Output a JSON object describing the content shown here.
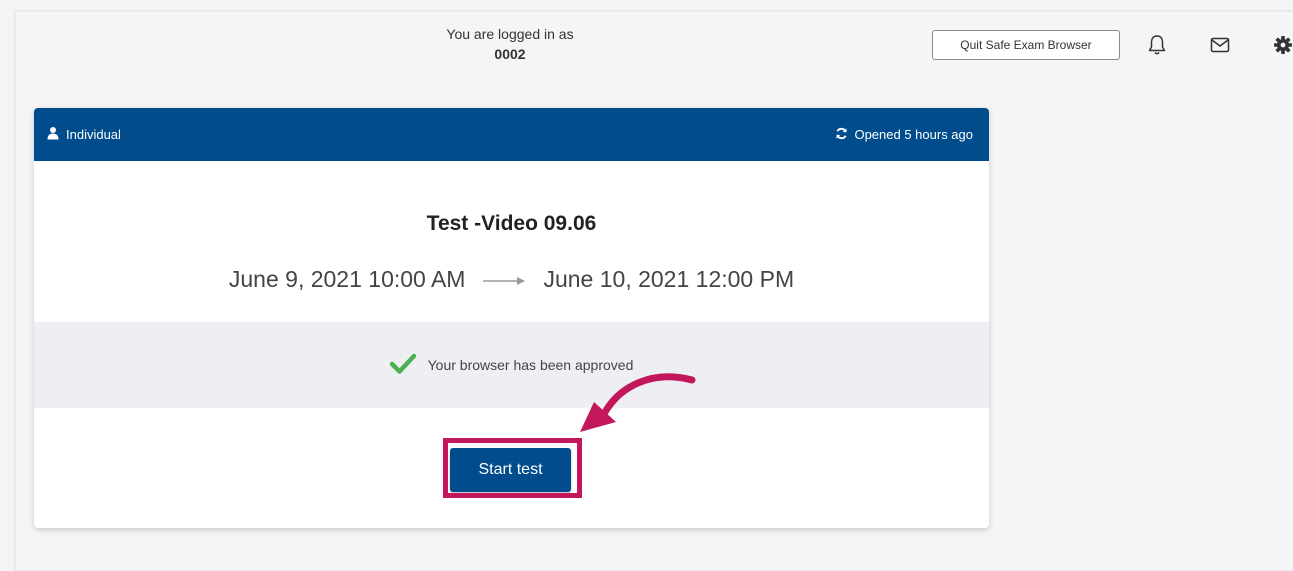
{
  "header": {
    "logged_in_label": "You are logged in as",
    "user_id": "0002",
    "quit_button_label": "Quit Safe Exam Browser",
    "icons": [
      "bell-icon",
      "envelope-icon",
      "gear-icon"
    ]
  },
  "card": {
    "mode_label": "Individual",
    "mode_icon": "user-icon",
    "status_label": "Opened 5 hours ago",
    "status_icon": "refresh-icon",
    "test_title": "Test -Video 09.06",
    "start_date": "June 9, 2021 10:00 AM",
    "end_date": "June 10, 2021 12:00 PM",
    "approval_message": "Your browser has been approved",
    "approval_icon": "checkmark-icon",
    "start_button_label": "Start test"
  },
  "colors": {
    "header_blue": "#004c8c",
    "approve_green": "#4caf50",
    "annotation_magenta": "#c2185b"
  }
}
